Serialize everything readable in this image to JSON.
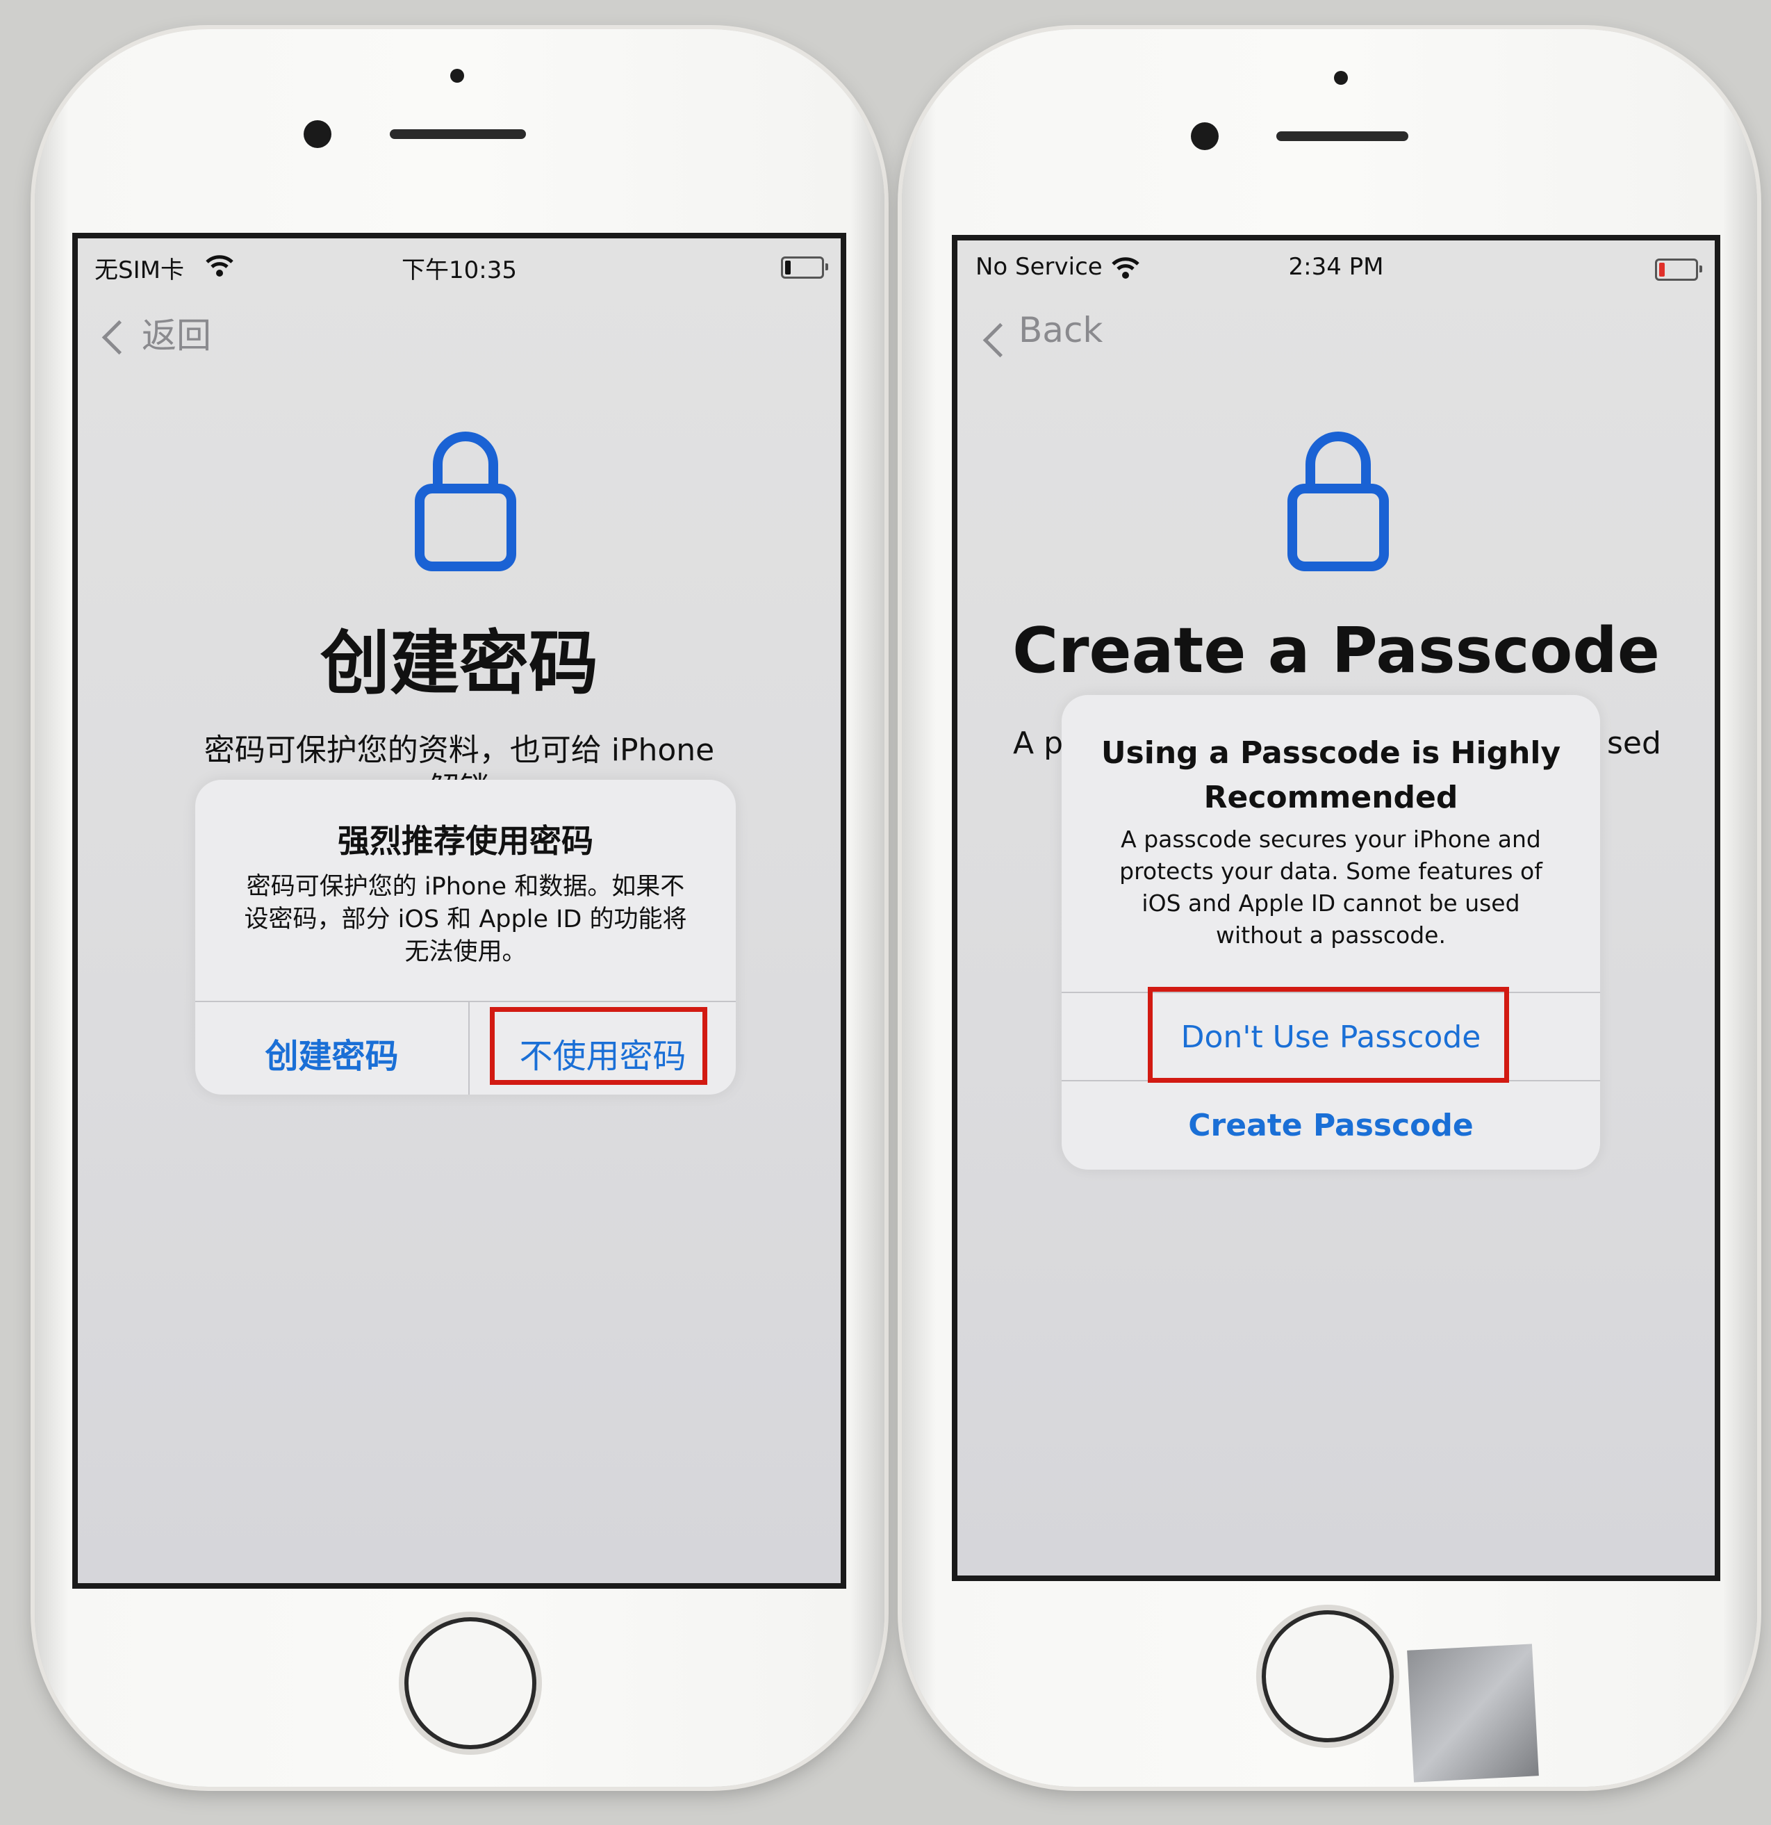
{
  "colors": {
    "accent_blue": "#1a6fd6",
    "highlight_red": "#d21a12",
    "battery_low": "#e0302a"
  },
  "left_phone": {
    "status": {
      "carrier": "无SIM卡",
      "time": "下午10:35",
      "wifi_icon": "wifi-icon",
      "battery_icon": "battery-icon"
    },
    "nav": {
      "back_label": "返回"
    },
    "page": {
      "icon": "lock-icon",
      "title": "创建密码",
      "subtitle": "密码可保护您的资料，也可给 iPhone",
      "subtitle_line2": "解锁"
    },
    "alert": {
      "title": "强烈推荐使用密码",
      "message_lines": [
        "密码可保护您的 iPhone 和数据。如果不",
        "设密码，部分 iOS 和 Apple ID 的功能将",
        "无法使用。"
      ],
      "buttons": [
        "创建密码",
        "不使用密码"
      ],
      "highlighted_button": "不使用密码"
    }
  },
  "right_phone": {
    "status": {
      "carrier": "No Service",
      "time": "2:34 PM",
      "wifi_icon": "wifi-icon",
      "battery_icon": "battery-icon"
    },
    "nav": {
      "back_label": "Back"
    },
    "page": {
      "icon": "lock-icon",
      "title": "Create a Passcode",
      "subtitle_left_fragment": "A pa",
      "subtitle_right_fragment": "sed"
    },
    "alert": {
      "title_lines": [
        "Using a Passcode is Highly",
        "Recommended"
      ],
      "message_lines": [
        "A passcode secures your iPhone and",
        "protects your data. Some features of",
        "iOS and Apple ID cannot be used",
        "without a passcode."
      ],
      "buttons": [
        "Don't Use Passcode",
        "Create Passcode"
      ],
      "highlighted_button": "Don't Use Passcode"
    }
  }
}
